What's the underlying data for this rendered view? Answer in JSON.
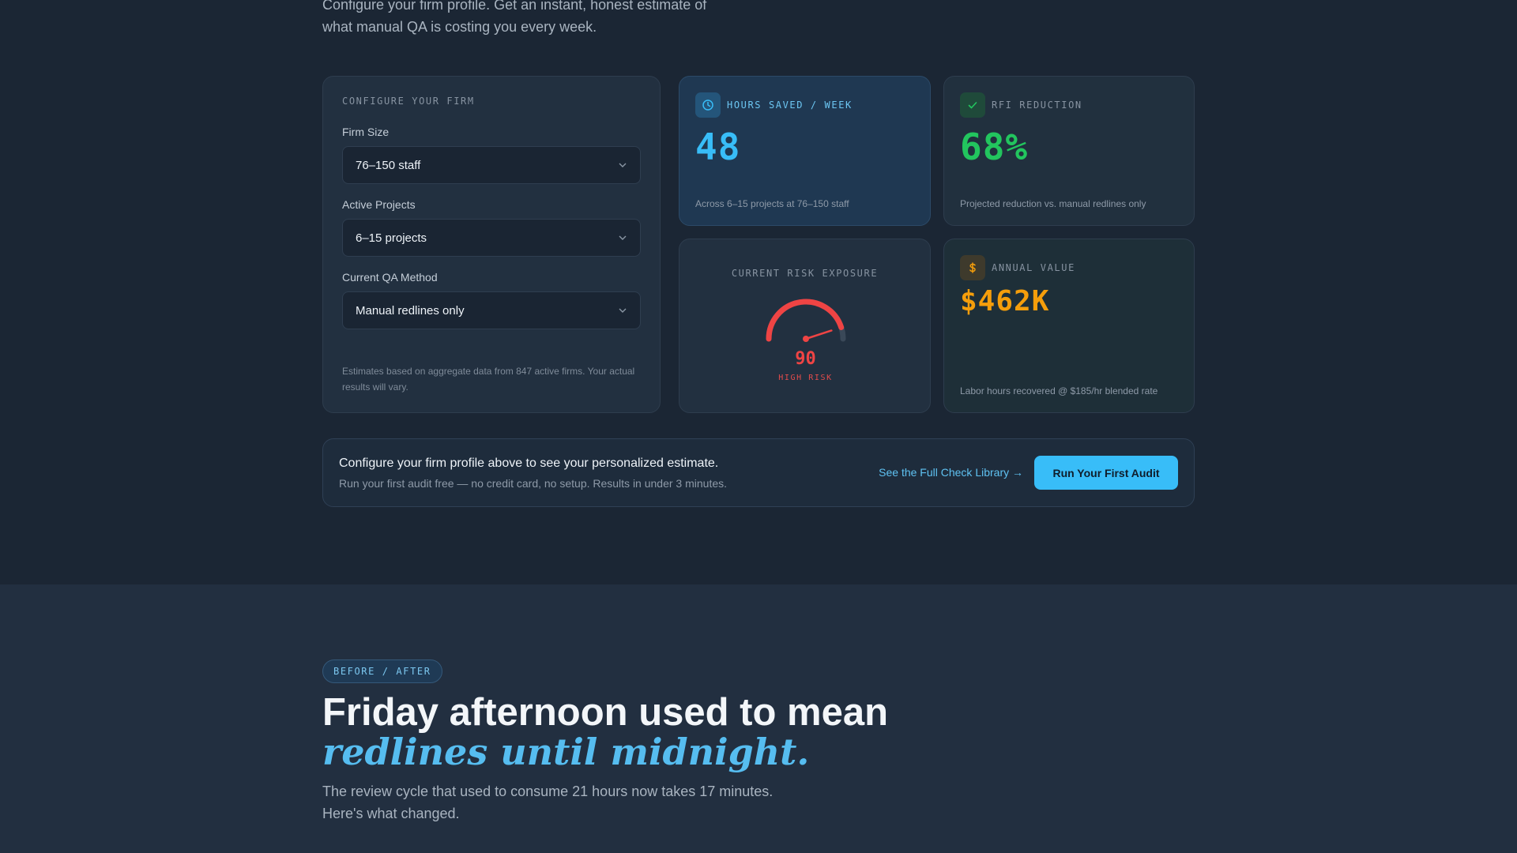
{
  "intro": {
    "line1": "Configure your firm profile. Get an instant, honest estimate of",
    "line2": "what manual QA is costing you every week."
  },
  "config": {
    "eyebrow": "CONFIGURE YOUR FIRM",
    "fields": [
      {
        "label": "Firm Size",
        "value": "76–150 staff"
      },
      {
        "label": "Active Projects",
        "value": "6–15 projects"
      },
      {
        "label": "Current QA Method",
        "value": "Manual redlines only"
      }
    ],
    "footnote": "Estimates based on aggregate data from 847 active firms. Your actual results will vary."
  },
  "metrics": {
    "hours": {
      "eyebrow": "HOURS SAVED / WEEK",
      "value": "48",
      "note": "Across 6–15 projects at 76–150 staff",
      "icon": "clock-icon",
      "color": "#38bdf8"
    },
    "rfi": {
      "eyebrow": "RFI REDUCTION",
      "value": "68%",
      "note": "Projected reduction vs. manual redlines only",
      "icon": "check-icon",
      "color": "#22c55e"
    },
    "risk": {
      "eyebrow": "CURRENT RISK EXPOSURE",
      "score": "90",
      "level": "HIGH RISK",
      "fraction": 0.9,
      "color": "#ef4444"
    },
    "value": {
      "eyebrow": "ANNUAL VALUE",
      "value": "$462K",
      "note": "Labor hours recovered @ $185/hr blended rate",
      "icon": "dollar-icon",
      "color": "#f59e0b"
    }
  },
  "cta": {
    "title": "Configure your firm profile above to see your personalized estimate.",
    "subtitle": "Run your first audit free — no credit card, no setup. Results in under 3 minutes.",
    "link": "See the Full Check Library →",
    "button": "Run Your First Audit"
  },
  "before_after": {
    "badge": "BEFORE / AFTER",
    "headline": "Friday afternoon used to mean",
    "headline_accent": "redlines until midnight.",
    "subhead_line1": "The review cycle that used to consume 21 hours now takes 17 minutes.",
    "subhead_line2": "Here's what changed."
  }
}
